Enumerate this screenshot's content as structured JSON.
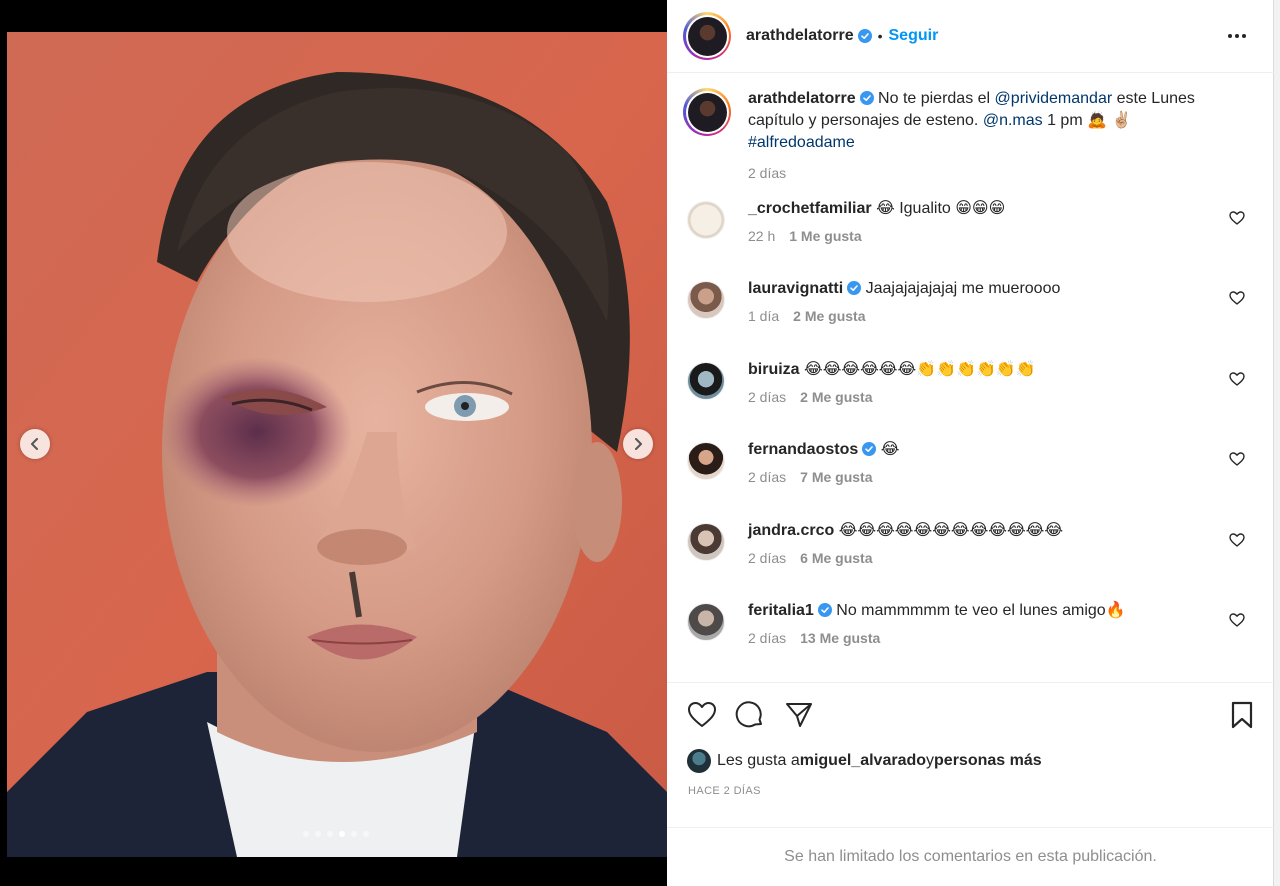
{
  "post": {
    "username": "arathdelatorre",
    "dot": "•",
    "follow_label": "Seguir",
    "carousel": {
      "total": 6,
      "active": 4
    }
  },
  "caption": {
    "username": "arathdelatorre",
    "text_1": " No te pierdas el ",
    "mention_1": "@privid​emandar",
    "text_2": " este Lunes capítulo y personajes de esteno. ",
    "mention_2": "@n.mas",
    "text_3": " 1 pm 🙇 ✌🏼",
    "hashtag": "#alfredoadame",
    "time": "2 días"
  },
  "comments": [
    {
      "username": "_crochetfamiliar",
      "verified": false,
      "text": "😂 Igualito 😁😁😁",
      "time": "22 h",
      "likes": "1 Me gusta"
    },
    {
      "username": "lauravignatti",
      "verified": true,
      "text": "Jaajajajajajaj me mueroooo",
      "time": "1 día",
      "likes": "2 Me gusta"
    },
    {
      "username": "biruiza",
      "verified": false,
      "text": "😂😂😂😂😂😂👏👏👏👏👏👏",
      "time": "2 días",
      "likes": "2 Me gusta"
    },
    {
      "username": "fernandaostos",
      "verified": true,
      "text": "😂",
      "time": "2 días",
      "likes": "7 Me gusta"
    },
    {
      "username": "jandra.crco",
      "verified": false,
      "text": "😂😂😂😂😂😂😂😂😂😂😂😂",
      "time": "2 días",
      "likes": "6 Me gusta"
    },
    {
      "username": "feritalia1",
      "verified": true,
      "text": "No mammmmm te veo el lunes amigo🔥",
      "time": "2 días",
      "likes": "13 Me gusta"
    }
  ],
  "likes": {
    "prefix": "Les gusta a ",
    "user": "miguel_alvarado",
    "middle": " y ",
    "suffix": "personas más"
  },
  "post_time": "HACE 2 DÍAS",
  "comments_limited": "Se han limitado los comentarios en esta publicación.",
  "icons": {
    "prev": "chevron-left-icon",
    "next": "chevron-right-icon",
    "more": "more-options-icon",
    "like": "heart-icon",
    "comment": "comment-icon",
    "share": "share-icon",
    "save": "bookmark-icon",
    "verified": "verified-badge-icon"
  },
  "colors": {
    "accent": "#0095f6",
    "verified": "#3897f0",
    "mention": "#00376b",
    "muted": "#8e8e8e",
    "wall": "#d6664d"
  }
}
